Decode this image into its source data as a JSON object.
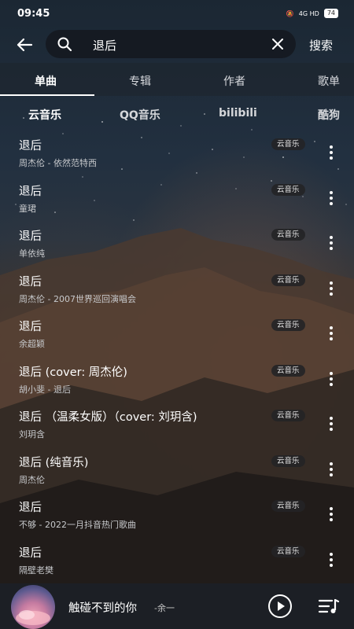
{
  "status": {
    "time": "09:45",
    "network": "4G HD",
    "battery": "74"
  },
  "search": {
    "query": "退后",
    "submit_label": "搜索"
  },
  "tabs": [
    {
      "label": "单曲",
      "active": true
    },
    {
      "label": "专辑",
      "active": false
    },
    {
      "label": "作者",
      "active": false
    },
    {
      "label": "歌单",
      "active": false
    }
  ],
  "sources": [
    {
      "label": "云音乐",
      "active": true
    },
    {
      "label": "QQ音乐",
      "active": false
    },
    {
      "label": "bilibili",
      "active": false
    },
    {
      "label": "酷狗",
      "active": false
    }
  ],
  "songs": [
    {
      "title": "退后",
      "subtitle": "周杰伦 - 依然范特西",
      "badge": "云音乐"
    },
    {
      "title": "退后",
      "subtitle": "童珺",
      "badge": "云音乐"
    },
    {
      "title": "退后",
      "subtitle": "单依纯",
      "badge": "云音乐"
    },
    {
      "title": "退后",
      "subtitle": "周杰伦 - 2007世界巡回演唱会",
      "badge": "云音乐"
    },
    {
      "title": "退后",
      "subtitle": "余超颖",
      "badge": "云音乐"
    },
    {
      "title": "退后 (cover: 周杰伦)",
      "subtitle": "胡小斐 - 退后",
      "badge": "云音乐"
    },
    {
      "title": "退后 （温柔女版）（cover: 刘玥含)",
      "subtitle": "刘玥含",
      "badge": "云音乐"
    },
    {
      "title": "退后 (纯音乐)",
      "subtitle": "周杰伦",
      "badge": "云音乐"
    },
    {
      "title": "退后",
      "subtitle": "不够 - 2022一月抖音热门歌曲",
      "badge": "云音乐"
    },
    {
      "title": "退后",
      "subtitle": "隔壁老樊",
      "badge": "云音乐"
    }
  ],
  "player": {
    "title": "触碰不到的你",
    "artist": "-余一"
  },
  "colors": {
    "background": "#1c2530",
    "search_box": "#14181e",
    "badge": "#232326"
  }
}
